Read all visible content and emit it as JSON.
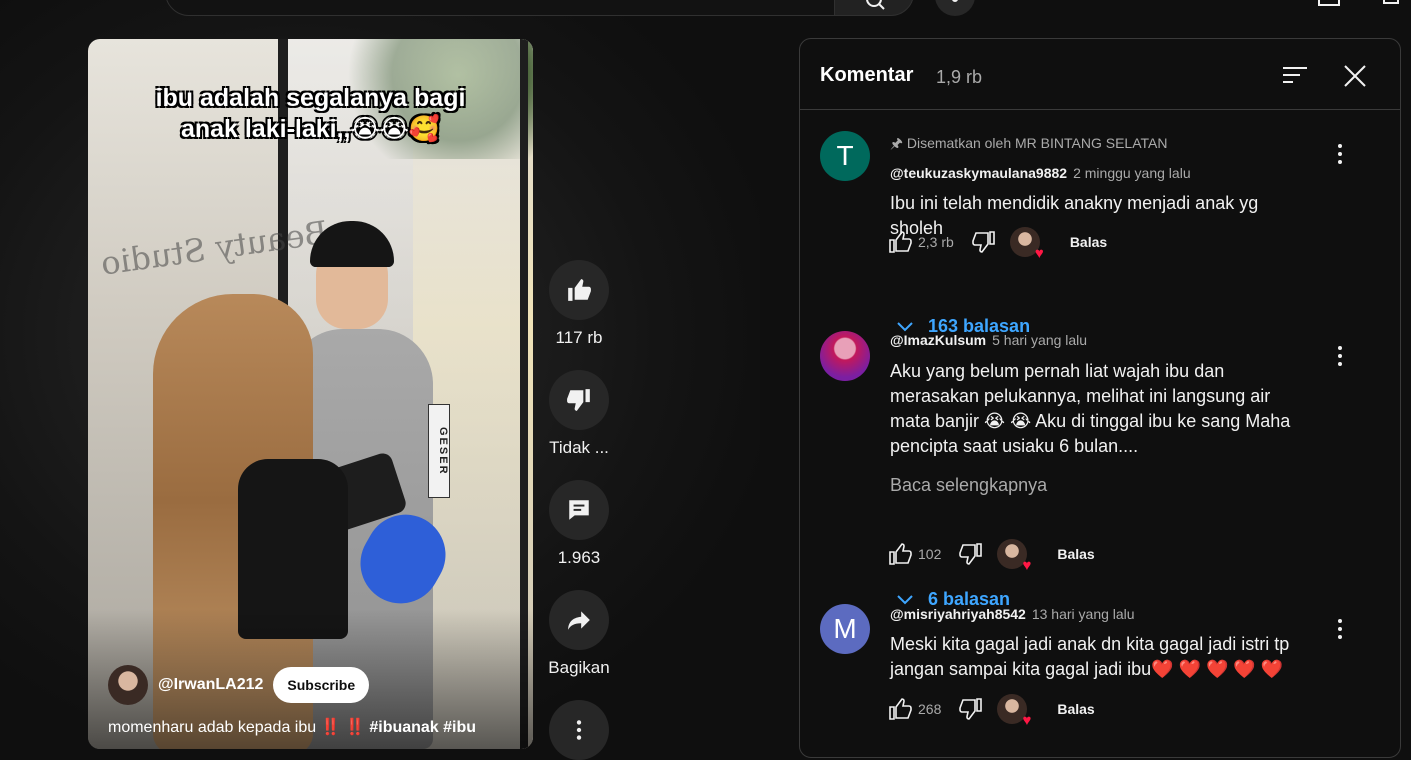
{
  "video": {
    "caption_line1": "ibu adalah segalanya bagi",
    "caption_line2": "anak laki-laki,,😭😭🥰",
    "sign_text": "Beauty Studio",
    "door_label": "GESER",
    "channel_name": "@IrwanLA212",
    "subscribe_label": "Subscribe",
    "description": "momenharu adab kepada ibu ‼️ ‼️",
    "description_tags": "#ibuanak #ibu"
  },
  "actions": {
    "like_count": "117 rb",
    "dislike_label": "Tidak ...",
    "comment_count": "1.963",
    "share_label": "Bagikan"
  },
  "comments_panel": {
    "title": "Komentar",
    "count": "1,9 rb",
    "items": [
      {
        "avatar_letter": "T",
        "avatar_color": "#00695c",
        "pinned": "Disematkan oleh MR BINTANG SELATAN",
        "author": "@teukuzaskymaulana9882",
        "time": "2 minggu yang lalu",
        "text": "Ibu ini telah mendidik anakny menjadi anak yg sholeh",
        "likes": "2,3 rb",
        "reply_label": "Balas",
        "replies_label": "163 balasan"
      },
      {
        "avatar_letter": "",
        "avatar_color": "#c2185b",
        "author": "@ImazKulsum",
        "time": "5 hari yang lalu",
        "text": "Aku yang belum pernah liat wajah ibu dan merasakan pelukannya, melihat ini langsung air mata banjir 😭 😭  Aku di tinggal ibu ke sang Maha pencipta saat usiaku 6 bulan....",
        "read_more": "Baca selengkapnya",
        "likes": "102",
        "reply_label": "Balas",
        "replies_label": "6 balasan"
      },
      {
        "avatar_letter": "M",
        "avatar_color": "#5c6bc0",
        "author": "@misriyahriyah8542",
        "time": "13 hari yang lalu",
        "text": "Meski kita gagal jadi anak dn kita gagal jadi istri tp jangan sampai kita gagal jadi ibu❤️ ❤️ ❤️ ❤️ ❤️",
        "likes": "268",
        "reply_label": "Balas"
      }
    ]
  },
  "colors": {
    "background": "#0f0f0f",
    "link_blue": "#3ea6ff",
    "heart_red": "#ff1744"
  }
}
